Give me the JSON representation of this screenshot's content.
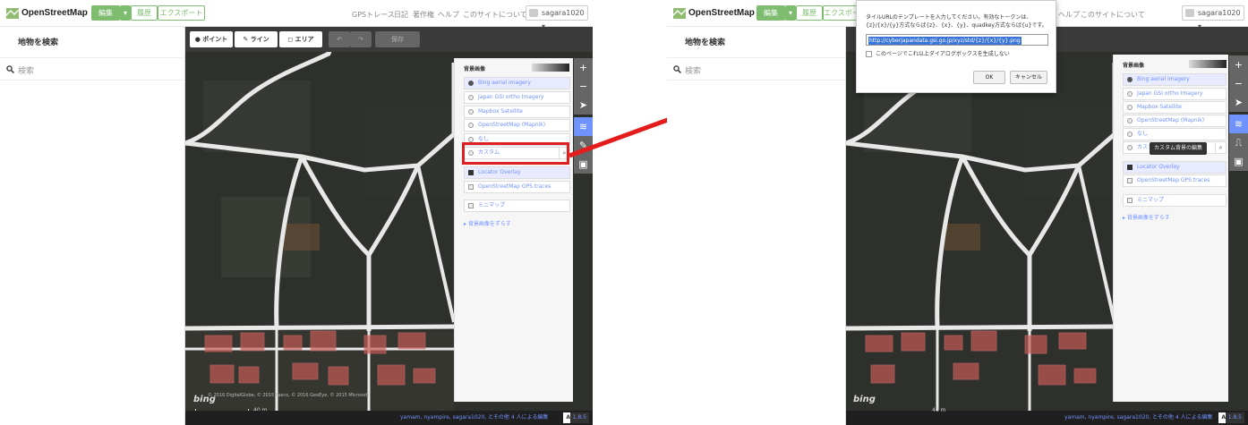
{
  "app": {
    "title": "OpenStreetMap"
  },
  "header": {
    "edit_label": "編集",
    "history_label": "履歴",
    "export_label": "エクスポート",
    "nav": [
      "GPSトレース",
      "日記",
      "著作権",
      "ヘルプ",
      "このサイトについて"
    ],
    "user": "sagara1020"
  },
  "sidebar": {
    "title": "地物を検索",
    "search_placeholder": "検索"
  },
  "toolbar": {
    "point_label": "ポイント",
    "line_label": "ライン",
    "area_label": "エリア",
    "save_label": "保存"
  },
  "background_panel": {
    "heading": "背景画像",
    "sources": [
      "Bing aerial imagery",
      "Japan GSI ortho Imagery",
      "Mapbox Satellite",
      "OpenStreetMap (Mapnik)",
      "なし",
      "カスタム"
    ],
    "selected": "Bing aerial imagery",
    "overlays": [
      {
        "label": "Locator Overlay",
        "checked": true
      },
      {
        "label": "OpenStreetMap GPS traces",
        "checked": false
      }
    ],
    "minimap_label": "ミニマップ",
    "offset_link": "▸ 背景画像をずらす"
  },
  "footer": {
    "attribution": "yamam, nyampire, sagara1020, とその他 4 人による編集",
    "version": "1.8.5",
    "lang": "A",
    "scale": "40 m",
    "copyright": "© 2016 DigitalGlobe, © 2015 Pasco, © 2016 GeoEye, © 2015 Microsoft"
  },
  "dialog": {
    "message": "タイルURLのテンプレートを入力してください。有効なトークンは、{z}/{x}/{y}方式ならば{z}、{x}、{y}、quadkey方式ならば{u}です。",
    "input_value": "http://cyberjapandata.gsi.go.jp/xyz/std/{z}/{x}/{y}.png",
    "checkbox_label": "このページでこれ以上ダイアログボックスを生成しない",
    "ok_label": "OK",
    "cancel_label": "キャンセル"
  },
  "tooltip": "カスタム背景の編集",
  "colors": {
    "accent": "#7ebc6f",
    "link": "#7092ff",
    "highlight": "#e02020"
  }
}
